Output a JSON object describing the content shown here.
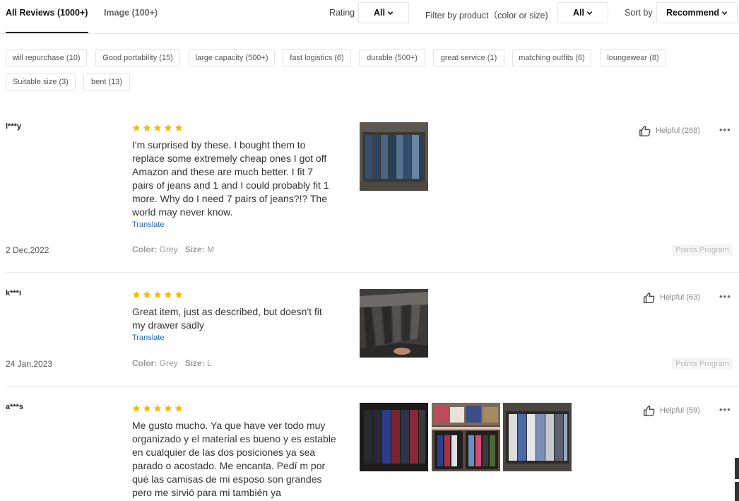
{
  "tabs": {
    "all": "All Reviews (1000+)",
    "image": "Image (100+)"
  },
  "filters": {
    "rating_label": "Rating",
    "rating_value": "All",
    "product_label": "Filter by product（color or size)",
    "product_value": "All",
    "sort_label": "Sort by",
    "sort_value": "Recommend"
  },
  "tags": [
    "will repurchase (10)",
    "Good portability (15)",
    "large capacity (500+)",
    "fast logistics (6)",
    "durable (500+)",
    "great service (1)",
    "matching outfits (6)",
    "loungewear (8)",
    "Suitable size (3)",
    "bent (13)"
  ],
  "reviews": [
    {
      "user": "l***y",
      "text": "I'm surprised by these. I bought them to replace some extremely cheap ones I got off Amazon and these are much better. I fit 7 pairs of jeans and 1 and I could probably fit 1 more. Why do I need 7 pairs of jeans?!? The world may never know.",
      "translate": "Translate",
      "helpful": "Helpful (268)",
      "date": "2 Dec,2022",
      "color_label": "Color:",
      "color": "Grey",
      "size_label": "Size:",
      "size": "M",
      "points": "Points Program"
    },
    {
      "user": "k***i",
      "text": "Great item, just as described, but doesn't fit my drawer sadly",
      "translate": "Translate",
      "helpful": "Helpful (63)",
      "date": "24 Jan,2023",
      "color_label": "Color:",
      "color": "Grey",
      "size_label": "Size:",
      "size": "L",
      "points": "Points Program"
    },
    {
      "user": "a***s",
      "text": "Me gusto mucho. Ya que have ver todo muy organizado y el material es bueno y es estable en cualquier de las dos posiciones ya sea parado o acostado. Me encanta. Pedí m por qué las camisas de mi esposo son grandes pero me sirvió para mi también ya",
      "helpful": "Helpful (59)"
    }
  ],
  "colors": {
    "star": "#f5b800",
    "link": "#2266bb",
    "accent": "#222222"
  },
  "icons": {
    "thumbs_up": "thumbs-up-icon",
    "more": "more-dots-icon",
    "chevron": "chevron-down-icon",
    "star": "star-icon"
  }
}
